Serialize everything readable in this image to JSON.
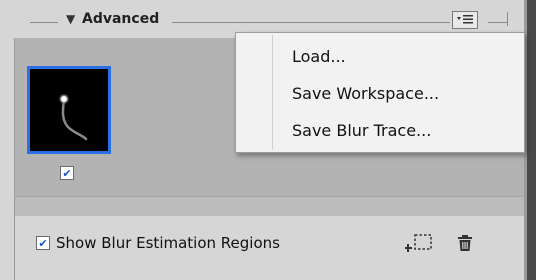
{
  "section": {
    "title": "Advanced",
    "collapse_glyph": "▼",
    "menu_button_icon": "panel-menu-icon"
  },
  "thumbnail": {
    "selected": true,
    "checked": true,
    "check_glyph": "✔"
  },
  "menu": {
    "items": [
      "Load...",
      "Save Workspace...",
      "Save Blur Trace..."
    ]
  },
  "footer": {
    "show_regions_label": "Show Blur Estimation Regions",
    "show_regions_checked": true,
    "check_glyph": "✔",
    "add_region_icon": "add-region-icon",
    "delete_icon": "trash-icon"
  },
  "colors": {
    "selection_border": "#2b6fe6",
    "checkmark": "#1d54c8",
    "panel_bg": "#d6d6d6",
    "thumb_area_bg": "#b3b3b3"
  }
}
